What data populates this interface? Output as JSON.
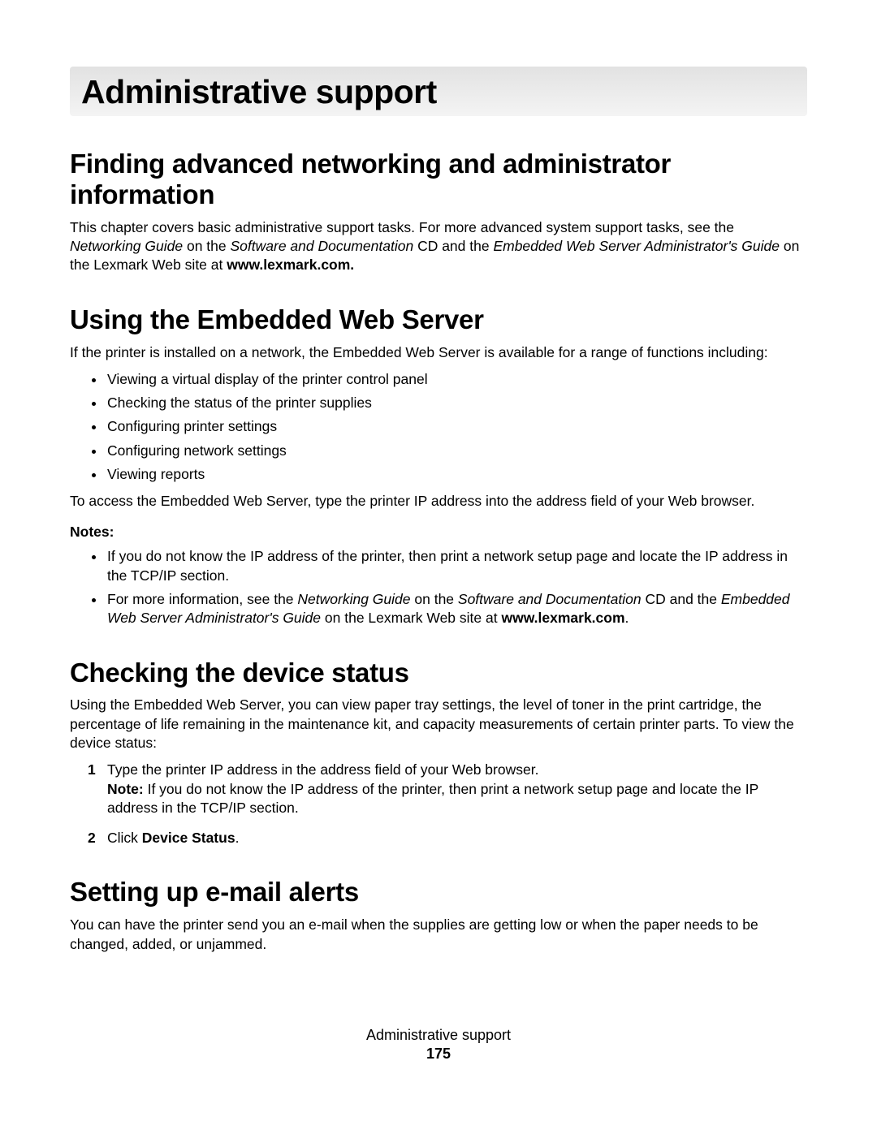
{
  "page_title": "Administrative support",
  "section1": {
    "heading": "Finding advanced networking and administrator information",
    "para_parts": [
      "This chapter covers basic administrative support tasks. For more advanced system support tasks, see the ",
      "Networking Guide",
      " on the ",
      "Software and Documentation",
      " CD and the ",
      "Embedded Web Server Administrator's Guide",
      " on the Lexmark Web site at ",
      "www.lexmark.com."
    ]
  },
  "section2": {
    "heading": "Using the Embedded Web Server",
    "intro": "If the printer is installed on a network, the Embedded Web Server is available for a range of functions including:",
    "bullets": [
      "Viewing a virtual display of the printer control panel",
      "Checking the status of the printer supplies",
      "Configuring printer settings",
      "Configuring network settings",
      "Viewing reports"
    ],
    "access": "To access the Embedded Web Server, type the printer IP address into the address field of your Web browser.",
    "notes_label": "Notes:",
    "notes": {
      "n1": "If you do not know the IP address of the printer, then print a network setup page and locate the IP address in the TCP/IP section.",
      "n2_parts": [
        "For more information, see the ",
        "Networking Guide",
        " on the ",
        "Software and Documentation",
        " CD and the ",
        "Embedded Web Server Administrator's Guide",
        " on the Lexmark Web site at ",
        "www.lexmark.com",
        "."
      ]
    }
  },
  "section3": {
    "heading": "Checking the device status",
    "intro": "Using the Embedded Web Server, you can view paper tray settings, the level of toner in the print cartridge, the percentage of life remaining in the maintenance kit, and capacity measurements of certain printer parts. To view the device status:",
    "step1": "Type the printer IP address in the address field of your Web browser.",
    "step1_note_parts": [
      "Note:",
      " If you do not know the IP address of the printer, then print a network setup page and locate the IP address in the TCP/IP section."
    ],
    "step2_parts": [
      "Click ",
      "Device Status",
      "."
    ]
  },
  "section4": {
    "heading": "Setting up e-mail alerts",
    "intro": "You can have the printer send you an e-mail when the supplies are getting low or when the paper needs to be changed, added, or unjammed."
  },
  "footer": {
    "title": "Administrative support",
    "page": "175"
  }
}
